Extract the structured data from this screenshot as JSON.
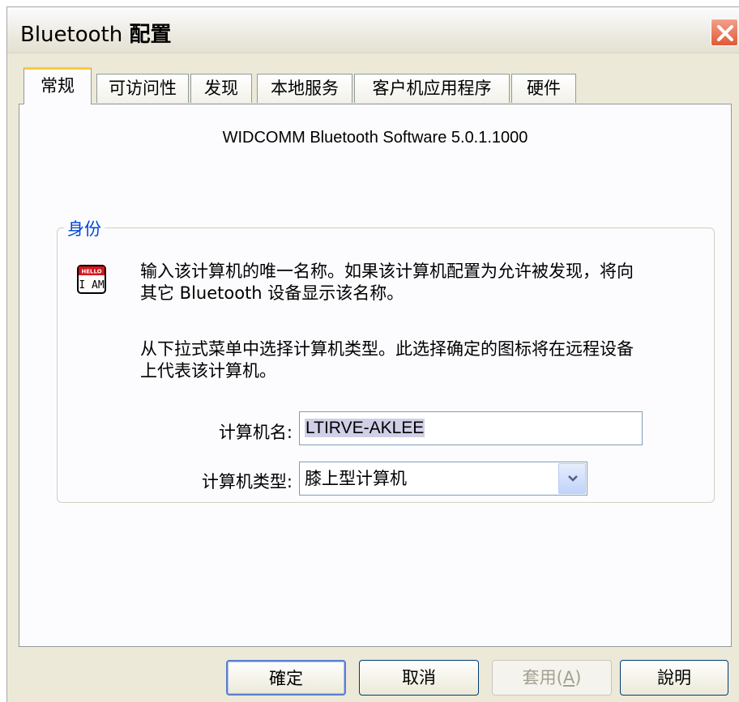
{
  "window": {
    "title_latin": "Bluetooth",
    "title_cjk": "配置"
  },
  "tabs": [
    "常规",
    "可访问性",
    "发现",
    "本地服务",
    "客户机应用程序",
    "硬件"
  ],
  "general": {
    "version": "WIDCOMM Bluetooth Software 5.0.1.1000",
    "group_label": "身份",
    "desc1_line1": "输入该计算机的唯一名称。如果该计算机配置为允许被发现，将向",
    "desc1_line2": "其它 Bluetooth 设备显示该名称。",
    "desc2_line1": "从下拉式菜单中选择计算机类型。此选择确定的图标将在远程设备",
    "desc2_line2": "上代表该计算机。",
    "name_label": "计算机名:",
    "name_value": "LTIRVE-AKLEE",
    "type_label": "计算机类型:",
    "type_value": "膝上型计算机",
    "icon_badge_top": "HELLO",
    "icon_badge_main": "I AM"
  },
  "buttons": {
    "ok": "確定",
    "cancel": "取消",
    "apply_prefix": "套用(",
    "apply_accel": "A",
    "apply_suffix": ")",
    "help": "說明"
  },
  "colors": {
    "tab_active_accent": "#ffc83c",
    "group_label": "#0046d5",
    "close_button": "#e05a37"
  }
}
